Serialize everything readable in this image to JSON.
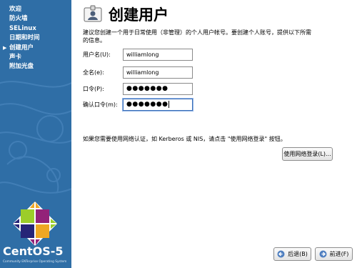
{
  "sidebar": {
    "steps": [
      {
        "label": "欢迎"
      },
      {
        "label": "防火墙"
      },
      {
        "label": "SELinux"
      },
      {
        "label": "日期和时间"
      },
      {
        "label": "创建用户"
      },
      {
        "label": "声卡"
      },
      {
        "label": "附加光盘"
      }
    ],
    "current_step_index": 4,
    "brand": "CentOS-5",
    "brand_sub": "Community ENTerprise Operating System",
    "colors": {
      "background": "#2f6ea6"
    }
  },
  "page": {
    "title": "创建用户",
    "description": "建议您创建一个用于日常使用（非管理）的个人用户帐号。要创建个人账号，提供以下所需的信息。"
  },
  "form": {
    "username": {
      "label": "用户名(U):",
      "value": "williamlong"
    },
    "fullname": {
      "label": "全名(e):",
      "value": "williamlong"
    },
    "password": {
      "label": "口令(P):",
      "value": "●●●●●●●"
    },
    "confirm": {
      "label": "确认口令(m):",
      "value": "●●●●●●●"
    }
  },
  "network": {
    "text": "如果您需要使用网络认证，如 Kerberos 或 NIS，请点击 \"使用网络登录\" 按钮。",
    "button_label": "使用网络登录(L)..."
  },
  "nav": {
    "back_label": "后退(B)",
    "forward_label": "前进(F)"
  }
}
